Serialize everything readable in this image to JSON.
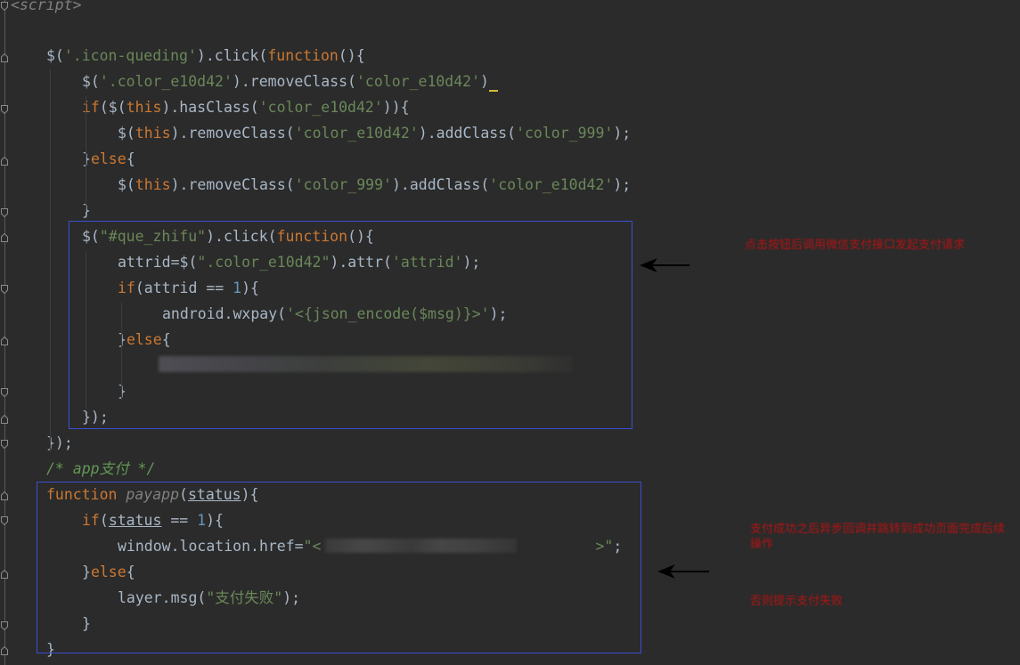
{
  "colors": {
    "background": "#2b2b2b",
    "text": "#a9b7c6",
    "keyword": "#cc7832",
    "string": "#6a8759",
    "function": "#ffc66d",
    "number": "#6897bb",
    "comment": "#629755",
    "annotation_box": "#3b4fd0",
    "annotation_text": "#b21414"
  },
  "editor": {
    "lines": [
      {
        "segments": [
          {
            "t": "<script>",
            "c": "it"
          }
        ]
      },
      {
        "segments": []
      },
      {
        "segments": [
          {
            "t": "$(",
            "c": ""
          },
          {
            "t": "'.icon-queding'",
            "c": "str"
          },
          {
            "t": ").click(",
            "c": ""
          },
          {
            "t": "function",
            "c": "kw"
          },
          {
            "t": "(){",
            "c": ""
          }
        ]
      },
      {
        "segments": [
          {
            "t": "$(",
            "c": ""
          },
          {
            "t": "'.color_e10d42'",
            "c": "str"
          },
          {
            "t": ").removeClass(",
            "c": ""
          },
          {
            "t": "'color_e10d42'",
            "c": "str"
          },
          {
            "t": ")",
            "c": ""
          },
          {
            "t": " ",
            "c": "cursor"
          }
        ]
      },
      {
        "segments": [
          {
            "t": "if",
            "c": "kw"
          },
          {
            "t": "($(",
            "c": ""
          },
          {
            "t": "this",
            "c": "kw"
          },
          {
            "t": ").hasClass(",
            "c": ""
          },
          {
            "t": "'color_e10d42'",
            "c": "str"
          },
          {
            "t": ")){",
            "c": ""
          }
        ]
      },
      {
        "segments": [
          {
            "t": "$(",
            "c": ""
          },
          {
            "t": "this",
            "c": "kw"
          },
          {
            "t": ").removeClass(",
            "c": ""
          },
          {
            "t": "'color_e10d42'",
            "c": "str"
          },
          {
            "t": ").addClass(",
            "c": ""
          },
          {
            "t": "'color_999'",
            "c": "str"
          },
          {
            "t": ");",
            "c": ""
          }
        ]
      },
      {
        "segments": [
          {
            "t": "}",
            "c": ""
          },
          {
            "t": "else",
            "c": "kw"
          },
          {
            "t": "{",
            "c": ""
          }
        ]
      },
      {
        "segments": [
          {
            "t": "$(",
            "c": ""
          },
          {
            "t": "this",
            "c": "kw"
          },
          {
            "t": ").removeClass(",
            "c": ""
          },
          {
            "t": "'color_999'",
            "c": "str"
          },
          {
            "t": ").addClass(",
            "c": ""
          },
          {
            "t": "'color_e10d42'",
            "c": "str"
          },
          {
            "t": ");",
            "c": ""
          }
        ]
      },
      {
        "segments": [
          {
            "t": "}",
            "c": ""
          }
        ]
      },
      {
        "segments": [
          {
            "t": "$(",
            "c": ""
          },
          {
            "t": "\"#que_zhifu\"",
            "c": "str"
          },
          {
            "t": ").click(",
            "c": ""
          },
          {
            "t": "function",
            "c": "kw"
          },
          {
            "t": "(){",
            "c": ""
          }
        ]
      },
      {
        "segments": [
          {
            "t": "attrid=$(",
            "c": ""
          },
          {
            "t": "\".color_e10d42\"",
            "c": "str"
          },
          {
            "t": ").attr(",
            "c": ""
          },
          {
            "t": "'attrid'",
            "c": "str"
          },
          {
            "t": ");",
            "c": ""
          }
        ]
      },
      {
        "segments": [
          {
            "t": "if",
            "c": "kw"
          },
          {
            "t": "(attrid == ",
            "c": ""
          },
          {
            "t": "1",
            "c": "num"
          },
          {
            "t": "){",
            "c": ""
          }
        ]
      },
      {
        "segments": [
          {
            "t": "android.wxpay(",
            "c": ""
          },
          {
            "t": "'<{json_encode($msg)}>'",
            "c": "str"
          },
          {
            "t": ");",
            "c": ""
          }
        ]
      },
      {
        "segments": [
          {
            "t": "}",
            "c": ""
          },
          {
            "t": "else",
            "c": "kw"
          },
          {
            "t": "{",
            "c": ""
          }
        ]
      },
      {
        "segments": []
      },
      {
        "segments": [
          {
            "t": "}",
            "c": ""
          }
        ]
      },
      {
        "segments": [
          {
            "t": "});",
            "c": ""
          }
        ]
      },
      {
        "segments": [
          {
            "t": "});",
            "c": ""
          }
        ]
      },
      {
        "segments": [
          {
            "t": "/* app支付 */",
            "c": "cmt"
          }
        ]
      },
      {
        "segments": [
          {
            "t": "function ",
            "c": "kw"
          },
          {
            "t": "payapp",
            "c": "it"
          },
          {
            "t": "(",
            "c": ""
          },
          {
            "t": "status",
            "c": "ul"
          },
          {
            "t": "){",
            "c": ""
          }
        ]
      },
      {
        "segments": [
          {
            "t": "if",
            "c": "kw"
          },
          {
            "t": "(",
            "c": ""
          },
          {
            "t": "status",
            "c": "ul"
          },
          {
            "t": " == ",
            "c": ""
          },
          {
            "t": "1",
            "c": "num"
          },
          {
            "t": "){",
            "c": ""
          }
        ]
      },
      {
        "segments": [
          {
            "t": "window.location.href=",
            "c": ""
          },
          {
            "t": "\"<",
            "c": "str"
          },
          {
            "t": "                               ",
            "c": ""
          },
          {
            "t": ">\"",
            "c": "str"
          },
          {
            "t": ";",
            "c": ""
          }
        ]
      },
      {
        "segments": [
          {
            "t": "}",
            "c": ""
          },
          {
            "t": "else",
            "c": "kw"
          },
          {
            "t": "{",
            "c": ""
          }
        ]
      },
      {
        "segments": [
          {
            "t": "layer.msg(",
            "c": ""
          },
          {
            "t": "\"支付失败\"",
            "c": "str"
          },
          {
            "t": ");",
            "c": ""
          }
        ]
      },
      {
        "segments": [
          {
            "t": "}",
            "c": ""
          }
        ]
      },
      {
        "segments": [
          {
            "t": "}",
            "c": ""
          }
        ]
      }
    ]
  },
  "annotations": {
    "note_1": "点击按钮后调用微信支付接口发起支付请求",
    "note_2": "支付成功之后异步回调并跳转到成功页面完成后续操作",
    "note_3": "否则提示支付失败"
  }
}
